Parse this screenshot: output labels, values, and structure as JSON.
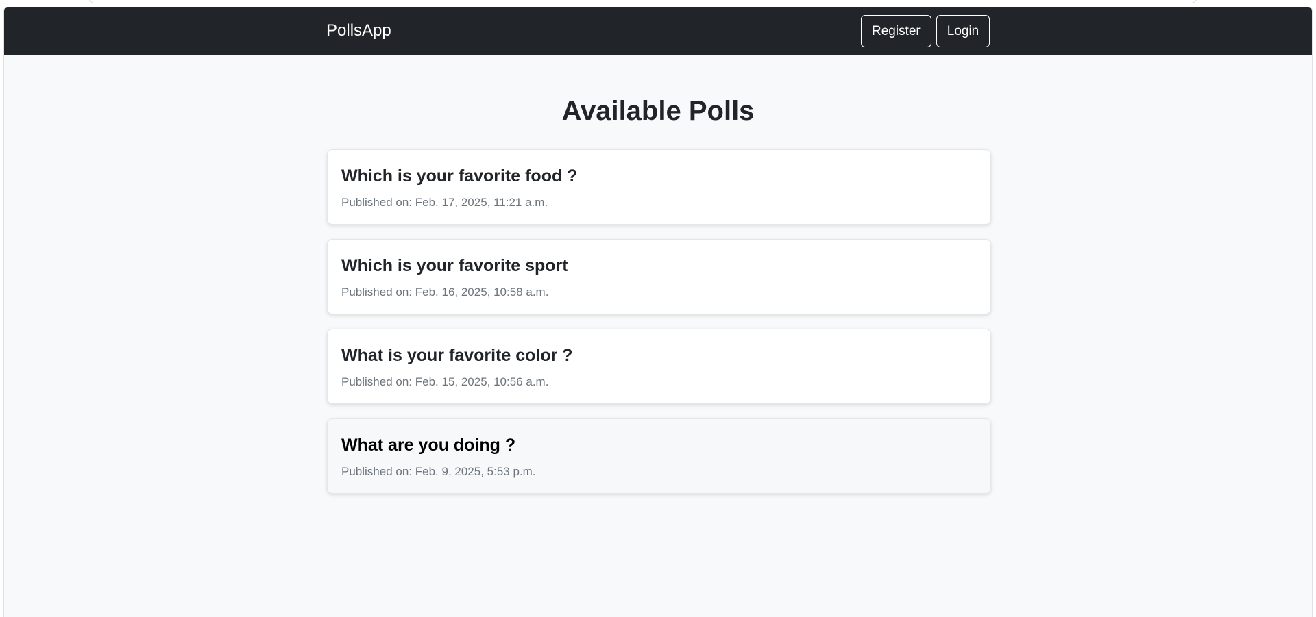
{
  "navbar": {
    "brand": "PollsApp",
    "register_label": "Register",
    "login_label": "Login"
  },
  "main": {
    "title": "Available Polls",
    "polls": [
      {
        "question": "Which is your favorite food ?",
        "published": "Published on: Feb. 17, 2025, 11:21 a.m."
      },
      {
        "question": "Which is your favorite sport",
        "published": "Published on: Feb. 16, 2025, 10:58 a.m."
      },
      {
        "question": "What is your favorite color ?",
        "published": "Published on: Feb. 15, 2025, 10:56 a.m."
      },
      {
        "question": "What are you doing ?",
        "published": "Published on: Feb. 9, 2025, 5:53 p.m."
      }
    ]
  },
  "colors": {
    "navbar_bg": "#212529",
    "page_bg": "#f8f9fa",
    "card_bg": "#ffffff",
    "muted_text": "#6c757d"
  }
}
